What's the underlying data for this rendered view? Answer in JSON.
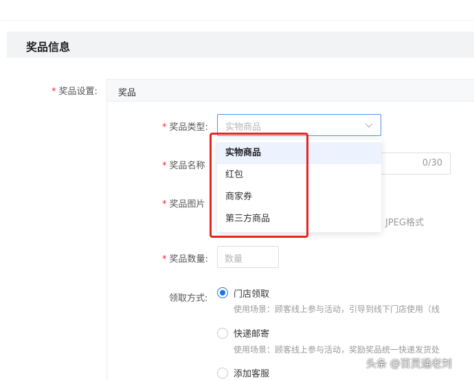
{
  "section": {
    "title": "奖品信息"
  },
  "prize_setting": {
    "label": "奖品设置:",
    "tab": "奖品"
  },
  "prize_type": {
    "label": "奖品类型:",
    "placeholder": "实物商品"
  },
  "prize_name": {
    "label": "奖品名称",
    "counter": "0/30"
  },
  "prize_image": {
    "label": "奖品图片",
    "hint": "、JPEG格式"
  },
  "prize_quantity": {
    "label": "奖品数量:",
    "placeholder": "数量"
  },
  "claim_method": {
    "label": "领取方式:",
    "options": [
      {
        "label": "门店领取",
        "desc": "使用场景：顾客线上参与活动，引导到线下门店使用（线",
        "checked": true
      },
      {
        "label": "快递邮寄",
        "desc": "使用场景：顾客线上参与活动，奖励奖品统一快递发货处",
        "checked": false
      },
      {
        "label": "添加客服",
        "desc": "",
        "checked": false
      }
    ]
  },
  "dropdown": {
    "options": [
      "实物商品",
      "红包",
      "商家券",
      "第三方商品"
    ],
    "highlighted": "实物商品"
  },
  "annotation_color": "#e8231e",
  "accent_color": "#1a73e8",
  "watermark": "头条 @百灵通老刘"
}
